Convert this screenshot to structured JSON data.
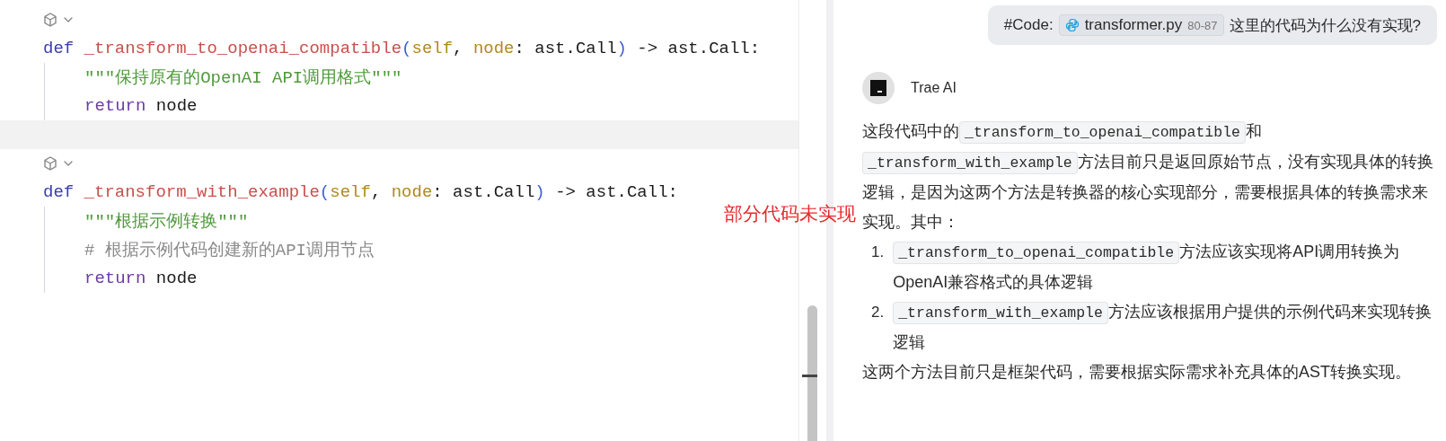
{
  "editor": {
    "lines": [
      {
        "kind": "lens",
        "highlighted": false
      },
      {
        "kind": "def",
        "highlighted": false,
        "tokens": [
          {
            "kind": "keyword",
            "text": "def"
          },
          {
            "kind": "function",
            "text": "_transform_to_openai_compatible"
          },
          {
            "kind": "paren",
            "text": "("
          },
          {
            "kind": "param",
            "text": "self"
          },
          {
            "kind": "plain",
            "text": ", "
          },
          {
            "kind": "param",
            "text": "node"
          },
          {
            "kind": "plain",
            "text": ": ast.Call"
          },
          {
            "kind": "paren",
            "text": ")"
          },
          {
            "kind": "plain",
            "text": " -> ast.Call:"
          }
        ]
      },
      {
        "kind": "body",
        "highlighted": false,
        "tokens": [
          {
            "kind": "string",
            "text": "\"\"\"保持原有的OpenAI API调用格式\"\"\""
          }
        ]
      },
      {
        "kind": "body",
        "highlighted": false,
        "tokens": [
          {
            "kind": "return",
            "text": "return"
          },
          {
            "kind": "plain",
            "text": " node"
          }
        ]
      },
      {
        "kind": "blank",
        "highlighted": true
      },
      {
        "kind": "lens",
        "highlighted": false
      },
      {
        "kind": "def",
        "highlighted": false,
        "tokens": [
          {
            "kind": "keyword",
            "text": "def"
          },
          {
            "kind": "function",
            "text": "_transform_with_example"
          },
          {
            "kind": "paren",
            "text": "("
          },
          {
            "kind": "param",
            "text": "self"
          },
          {
            "kind": "plain",
            "text": ", "
          },
          {
            "kind": "param",
            "text": "node"
          },
          {
            "kind": "plain",
            "text": ": ast.Call"
          },
          {
            "kind": "paren",
            "text": ")"
          },
          {
            "kind": "plain",
            "text": " -> ast.Call:"
          }
        ]
      },
      {
        "kind": "body",
        "highlighted": false,
        "tokens": [
          {
            "kind": "string",
            "text": "\"\"\"根据示例转换\"\"\""
          }
        ]
      },
      {
        "kind": "body",
        "highlighted": false,
        "tokens": [
          {
            "kind": "comment",
            "text": "# 根据示例代码创建新的API调用节点"
          }
        ]
      },
      {
        "kind": "body",
        "highlighted": false,
        "tokens": [
          {
            "kind": "return",
            "text": "return"
          },
          {
            "kind": "plain",
            "text": " node"
          }
        ]
      }
    ]
  },
  "annotation": "部分代码未实现",
  "chat": {
    "user_message": {
      "prefix": "#Code:",
      "file": {
        "name": "transformer.py",
        "range": "80-87"
      },
      "text": "这里的代码为什么没有实现?"
    },
    "assistant": {
      "name": "Trae AI",
      "content": [
        {
          "kind": "paragraph",
          "segments": [
            {
              "kind": "text",
              "text": "这段代码中的"
            },
            {
              "kind": "code",
              "text": "_transform_to_openai_compatible"
            },
            {
              "kind": "text",
              "text": "和"
            },
            {
              "kind": "code",
              "text": "_transform_with_example"
            },
            {
              "kind": "text",
              "text": "方法目前只是返回原始节点，没有实现具体的转换逻辑，是因为这两个方法是转换器的核心实现部分，需要根据具体的转换需求来实现。其中："
            }
          ]
        },
        {
          "kind": "list",
          "items": [
            {
              "marker": "1.",
              "segments": [
                {
                  "kind": "code",
                  "text": "_transform_to_openai_compatible"
                },
                {
                  "kind": "text",
                  "text": "方法应该实现将API调用转换为OpenAI兼容格式的具体逻辑"
                }
              ]
            },
            {
              "marker": "2.",
              "segments": [
                {
                  "kind": "code",
                  "text": "_transform_with_example"
                },
                {
                  "kind": "text",
                  "text": "方法应该根据用户提供的示例代码来实现转换逻辑"
                }
              ]
            }
          ]
        },
        {
          "kind": "paragraph",
          "segments": [
            {
              "kind": "text",
              "text": "这两个方法目前只是框架代码，需要根据实际需求补充具体的AST转换实现。"
            }
          ]
        }
      ]
    }
  }
}
